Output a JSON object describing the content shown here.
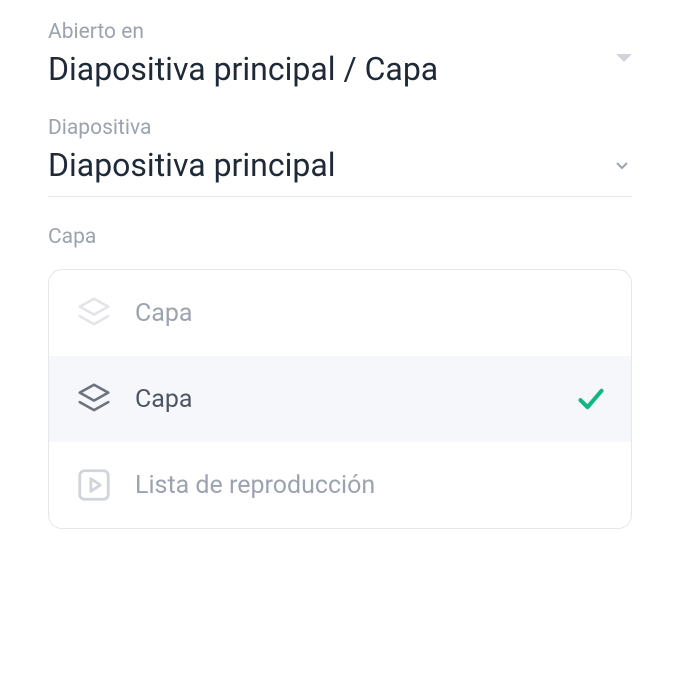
{
  "openIn": {
    "label": "Abierto en",
    "value": "Diapositiva principal / Capa"
  },
  "slide": {
    "label": "Diapositiva",
    "value": "Diapositiva principal"
  },
  "layer": {
    "label": "Capa",
    "options": [
      {
        "label": "Capa",
        "icon": "layers-icon",
        "selected": false
      },
      {
        "label": "Capa",
        "icon": "layers-icon",
        "selected": true
      },
      {
        "label": "Lista de reproducción",
        "icon": "playlist-icon",
        "selected": false
      }
    ]
  }
}
